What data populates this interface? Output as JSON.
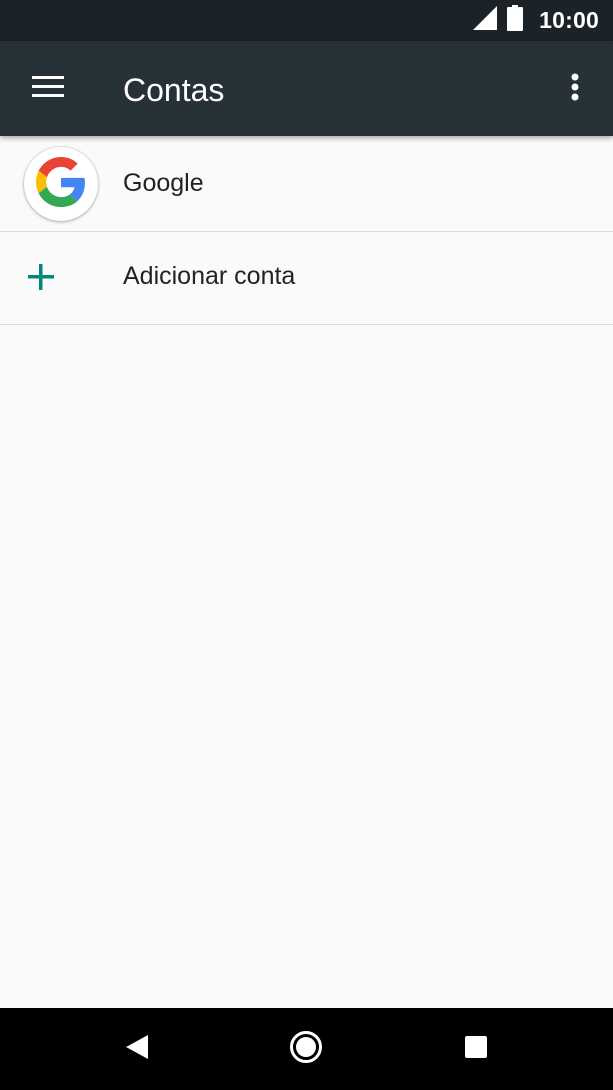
{
  "status_bar": {
    "time": "10:00",
    "icons": [
      "signal-icon",
      "battery-icon"
    ]
  },
  "app_bar": {
    "title": "Contas",
    "icons": [
      "menu-icon",
      "more-vert-icon"
    ],
    "background": "#263238"
  },
  "accounts": {
    "items": [
      {
        "label": "Google",
        "icon": "google-logo-icon"
      }
    ],
    "add_account": {
      "label": "Adicionar conta",
      "icon": "plus-icon",
      "accent": "#00897b"
    }
  },
  "nav_bar": {
    "icons": [
      "back-icon",
      "home-icon",
      "recents-icon"
    ]
  }
}
